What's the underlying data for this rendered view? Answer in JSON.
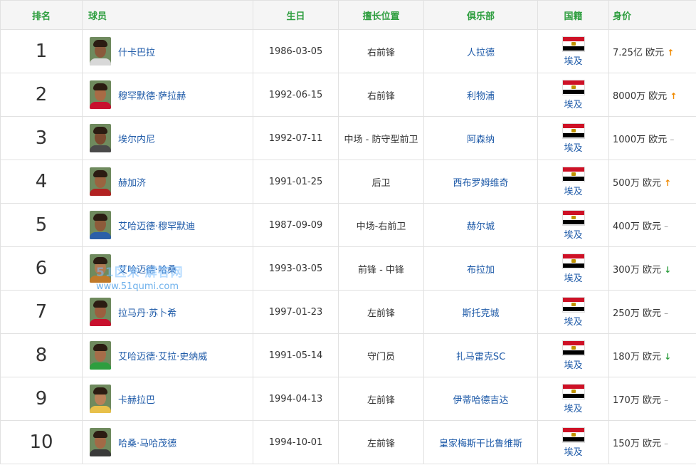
{
  "headers": {
    "rank": "排名",
    "player": "球员",
    "birth": "生日",
    "position": "擅长位置",
    "club": "俱乐部",
    "nationality": "国籍",
    "value": "身价"
  },
  "colors": {
    "header_text": "#2e9e3f",
    "link": "#1e5aa8",
    "trend_up": "#f08a00",
    "trend_down": "#2e9e3f",
    "trend_flat": "#999999"
  },
  "rows": [
    {
      "rank": "1",
      "name": "什卡巴拉",
      "birth": "1986-03-05",
      "position": "右前锋",
      "club": "人拉德",
      "nationality": "埃及",
      "value": "7.25亿 欧元",
      "trend": "up",
      "trend_icon": "↑"
    },
    {
      "rank": "2",
      "name": "穆罕默德·萨拉赫",
      "birth": "1992-06-15",
      "position": "右前锋",
      "club": "利物浦",
      "nationality": "埃及",
      "value": "8000万 欧元",
      "trend": "up",
      "trend_icon": "↑"
    },
    {
      "rank": "3",
      "name": "埃尔内尼",
      "birth": "1992-07-11",
      "position": "中场 - 防守型前卫",
      "club": "阿森纳",
      "nationality": "埃及",
      "value": "1000万 欧元",
      "trend": "flat",
      "trend_icon": "–"
    },
    {
      "rank": "4",
      "name": "赫加济",
      "birth": "1991-01-25",
      "position": "后卫",
      "club": "西布罗姆维奇",
      "nationality": "埃及",
      "value": "500万 欧元",
      "trend": "up",
      "trend_icon": "↑"
    },
    {
      "rank": "5",
      "name": "艾哈迈德·穆罕默迪",
      "birth": "1987-09-09",
      "position": "中场-右前卫",
      "club": "赫尔城",
      "nationality": "埃及",
      "value": "400万 欧元",
      "trend": "flat",
      "trend_icon": "–"
    },
    {
      "rank": "6",
      "name": "艾哈迈德·哈桑",
      "birth": "1993-03-05",
      "position": "前锋 - 中锋",
      "club": "布拉加",
      "nationality": "埃及",
      "value": "300万 欧元",
      "trend": "down",
      "trend_icon": "↓"
    },
    {
      "rank": "7",
      "name": "拉马丹·苏卜希",
      "birth": "1997-01-23",
      "position": "左前锋",
      "club": "斯托克城",
      "nationality": "埃及",
      "value": "250万 欧元",
      "trend": "flat",
      "trend_icon": "–"
    },
    {
      "rank": "8",
      "name": "艾哈迈德·艾拉·史纳威",
      "birth": "1991-05-14",
      "position": "守门员",
      "club": "扎马雷克SC",
      "nationality": "埃及",
      "value": "180万 欧元",
      "trend": "down",
      "trend_icon": "↓"
    },
    {
      "rank": "9",
      "name": "卡赫拉巴",
      "birth": "1994-04-13",
      "position": "左前锋",
      "club": "伊蒂哈德吉达",
      "nationality": "埃及",
      "value": "170万 欧元",
      "trend": "flat",
      "trend_icon": "–"
    },
    {
      "rank": "10",
      "name": "哈桑·马哈茂德",
      "birth": "1994-10-01",
      "position": "左前锋",
      "club": "皇家梅斯干比鲁维斯",
      "nationality": "埃及",
      "value": "150万 欧元",
      "trend": "flat",
      "trend_icon": "–"
    }
  ],
  "watermark": {
    "line1": "51区米 解答网",
    "line2": "www.51qumi.com"
  }
}
